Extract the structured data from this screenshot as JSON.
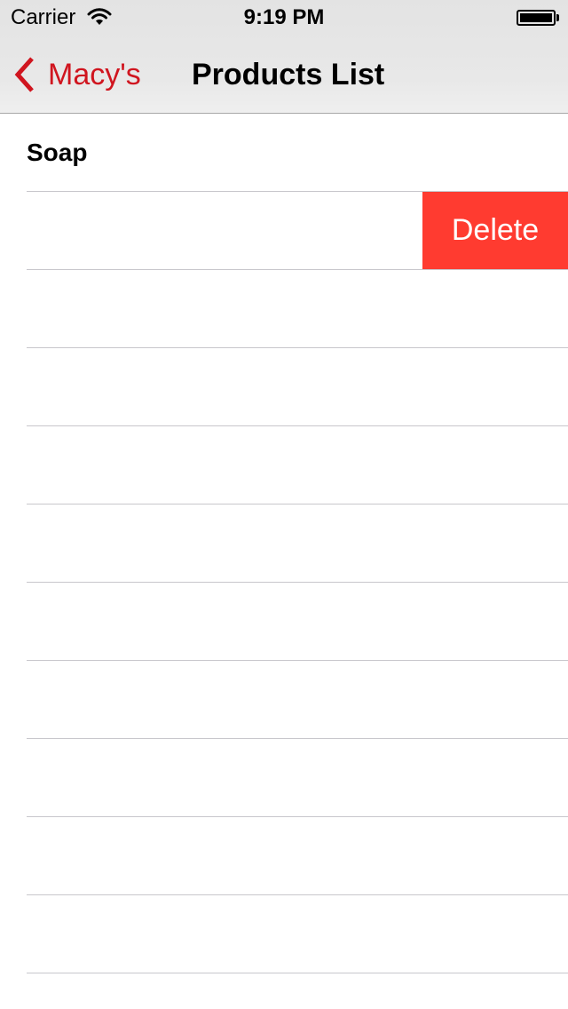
{
  "status_bar": {
    "carrier": "Carrier",
    "wifi_icon": "wifi-icon",
    "time": "9:19 PM",
    "battery_icon": "battery-icon"
  },
  "nav": {
    "back_icon": "chevron-left-icon",
    "back_label": "Macy's",
    "title": "Products List",
    "accent_color": "#d0151f"
  },
  "list": {
    "rows": [
      {
        "label": "Soap"
      },
      {
        "label": "",
        "action": "Delete"
      },
      {
        "label": ""
      },
      {
        "label": ""
      },
      {
        "label": ""
      },
      {
        "label": ""
      },
      {
        "label": ""
      },
      {
        "label": ""
      },
      {
        "label": ""
      },
      {
        "label": ""
      },
      {
        "label": ""
      }
    ],
    "delete_color": "#ff3b30"
  }
}
